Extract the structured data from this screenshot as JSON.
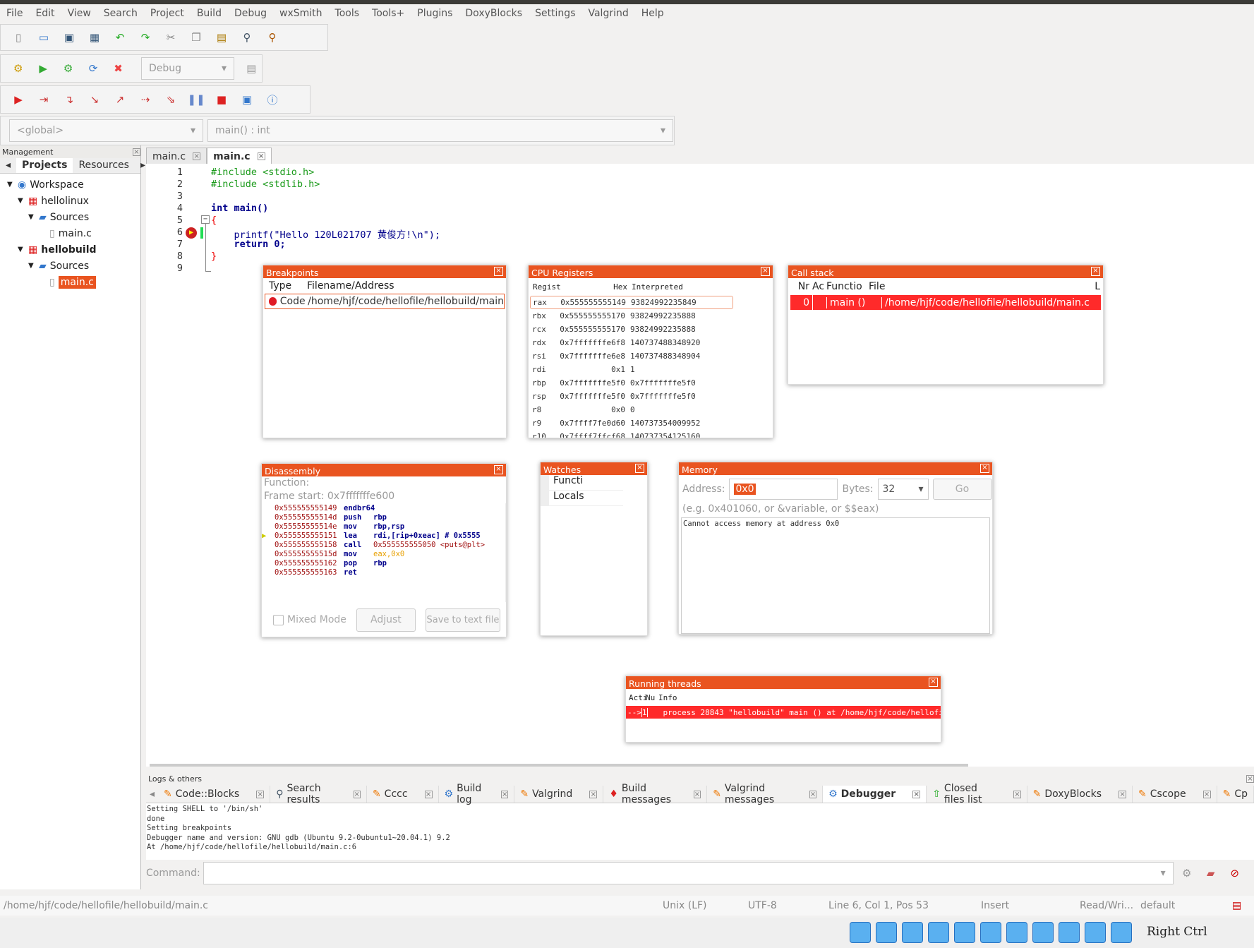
{
  "menu": [
    "File",
    "Edit",
    "View",
    "Search",
    "Project",
    "Build",
    "Debug",
    "wxSmith",
    "Tools",
    "Tools+",
    "Plugins",
    "DoxyBlocks",
    "Settings",
    "Valgrind",
    "Help"
  ],
  "toolbar": {
    "build_target": "Debug",
    "scope": "<global>",
    "function": "main() : int",
    "row1_icons": [
      "new-file-icon",
      "open-icon",
      "save-icon",
      "save-all-icon",
      "undo-icon",
      "redo-icon",
      "cut-icon",
      "copy-icon",
      "paste-icon",
      "find-icon",
      "replace-icon"
    ],
    "row2_icons": [
      "build-icon",
      "run-icon",
      "build-run-icon",
      "rebuild-icon",
      "abort-icon"
    ],
    "row3_icons": [
      "debug-run-icon",
      "run-to-cursor-icon",
      "next-line-icon",
      "step-into-icon",
      "step-out-icon",
      "next-instruction-icon",
      "step-into-instruction-icon",
      "pause-icon",
      "stop-debugger-icon",
      "debug-windows-icon",
      "info-icon"
    ]
  },
  "management": {
    "title": "Management",
    "tabs": [
      "Projects",
      "Resources"
    ],
    "tree": [
      {
        "label": "Workspace",
        "level": 0
      },
      {
        "label": "hellolinux",
        "level": 1
      },
      {
        "label": "Sources",
        "level": 2
      },
      {
        "label": "main.c",
        "level": 3
      },
      {
        "label": "hellobuild",
        "level": 1,
        "bold": true
      },
      {
        "label": "Sources",
        "level": 2
      },
      {
        "label": "main.c",
        "level": 3,
        "selected": true
      }
    ]
  },
  "editor": {
    "tabs": [
      "main.c",
      "main.c"
    ],
    "active_tab": 1,
    "lines": [
      "#include <stdio.h>",
      "#include <stdlib.h>",
      "",
      "int main()",
      "{",
      "    printf(\"Hello 120L021707 黄俊方!\\n\");",
      "    return 0;",
      "}",
      ""
    ]
  },
  "breakpoints": {
    "title": "Breakpoints",
    "cols": [
      "Type",
      "Filename/Address"
    ],
    "rows": [
      {
        "type": "Code",
        "file": "/home/hjf/code/hellofile/hellobuild/main"
      }
    ]
  },
  "registers": {
    "title": "CPU Registers",
    "cols": [
      "Registe",
      "Hex",
      "Interpreted"
    ],
    "rows": [
      [
        "rax",
        "0x555555555149",
        "93824992235849"
      ],
      [
        "rbx",
        "0x555555555170",
        "93824992235888"
      ],
      [
        "rcx",
        "0x555555555170",
        "93824992235888"
      ],
      [
        "rdx",
        "0x7fffffffe6f8",
        "140737488348920"
      ],
      [
        "rsi",
        "0x7fffffffe6e8",
        "140737488348904"
      ],
      [
        "rdi",
        "0x1",
        "1"
      ],
      [
        "rbp",
        "0x7fffffffe5f0",
        "0x7fffffffe5f0"
      ],
      [
        "rsp",
        "0x7fffffffe5f0",
        "0x7fffffffe5f0"
      ],
      [
        "r8",
        "0x0",
        "0"
      ],
      [
        "r9",
        "0x7ffff7fe0d60",
        "140737354009952"
      ],
      [
        "r10",
        "0x7ffff7ffcf68",
        "140737354125160"
      ]
    ]
  },
  "callstack": {
    "title": "Call stack",
    "cols": [
      "Nr",
      "Ac",
      "Functio",
      "File",
      "L"
    ],
    "rows": [
      [
        "0",
        "",
        "main ()",
        "/home/hjf/code/hellofile/hellobuild/main.c"
      ]
    ]
  },
  "disassembly": {
    "title": "Disassembly",
    "function_label": "Function:",
    "frame_start": "Frame start: 0x7fffffffe600",
    "rows": [
      [
        "0x555555555149",
        "endbr64",
        ""
      ],
      [
        "0x55555555514d",
        "push",
        "rbp"
      ],
      [
        "0x55555555514e",
        "mov",
        "rbp,rsp"
      ],
      [
        "0x555555555151",
        "lea",
        "rdi,[rip+0xeac]        # 0x5555"
      ],
      [
        "0x555555555158",
        "call",
        "0x555555555050 <puts@plt>"
      ],
      [
        "0x55555555515d",
        "mov",
        "eax,0x0"
      ],
      [
        "0x555555555162",
        "pop",
        "rbp"
      ],
      [
        "0x555555555163",
        "ret",
        ""
      ]
    ],
    "mixed_mode": "Mixed Mode",
    "adjust": "Adjust",
    "save": "Save to text file"
  },
  "watches": {
    "title": "Watches",
    "rows": [
      "Functi",
      "Locals"
    ]
  },
  "memory": {
    "title": "Memory",
    "address_label": "Address:",
    "address": "0x0",
    "bytes_label": "Bytes:",
    "bytes": "32",
    "go": "Go",
    "hint": "(e.g. 0x401060, or &variable, or $$eax)",
    "output": "Cannot access memory at address 0x0"
  },
  "threads": {
    "title": "Running threads",
    "cols": [
      "Acti",
      "Nu",
      "Info"
    ],
    "rows": [
      [
        "-->",
        "1",
        "process 28843 \"hellobuild\" main () at /home/hjf/code/hellofile/"
      ]
    ]
  },
  "logs": {
    "title": "Logs & others",
    "tabs": [
      "Code::Blocks",
      "Search results",
      "Cccc",
      "Build log",
      "Valgrind",
      "Build messages",
      "Valgrind messages",
      "Debugger",
      "Closed files list",
      "DoxyBlocks",
      "Cscope",
      "Cp"
    ],
    "active_tab": 7,
    "lines": [
      "Setting SHELL to '/bin/sh'",
      "done",
      "Setting breakpoints",
      "Debugger name and version: GNU gdb (Ubuntu 9.2-0ubuntu1~20.04.1) 9.2",
      "At /home/hjf/code/hellofile/hellobuild/main.c:6"
    ],
    "command_label": "Command:"
  },
  "status": {
    "path": "/home/hjf/code/hellofile/hellobuild/main.c",
    "eol": "Unix (LF)",
    "encoding": "UTF-8",
    "position": "Line 6, Col 1, Pos 53",
    "mode": "Insert",
    "access": "Read/Wri...",
    "profile": "default"
  },
  "taskbar": {
    "right_ctrl": "Right Ctrl"
  },
  "colors": {
    "accent": "#e95420",
    "highlight": "#ff2a2a"
  }
}
